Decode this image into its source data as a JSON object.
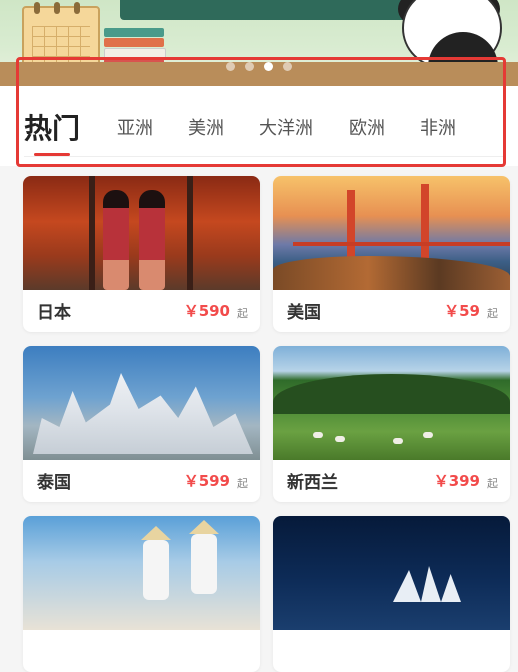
{
  "banner": {
    "carousel_total": 4,
    "carousel_active_index": 2
  },
  "tabs": [
    {
      "label": "热门",
      "active": true
    },
    {
      "label": "亚洲",
      "active": false
    },
    {
      "label": "美洲",
      "active": false
    },
    {
      "label": "大洋洲",
      "active": false
    },
    {
      "label": "欧洲",
      "active": false
    },
    {
      "label": "非洲",
      "active": false
    }
  ],
  "colors": {
    "accent": "#e53935",
    "price": "#f24b4b",
    "background": "#f5f5f5"
  },
  "destinations": [
    {
      "name": "日本",
      "price": "￥590",
      "suffix": "起"
    },
    {
      "name": "美国",
      "price": "￥59",
      "suffix": "起"
    },
    {
      "name": "泰国",
      "price": "￥599",
      "suffix": "起"
    },
    {
      "name": "新西兰",
      "price": "￥399",
      "suffix": "起"
    },
    {
      "name": "",
      "price": "",
      "suffix": ""
    },
    {
      "name": "",
      "price": "",
      "suffix": ""
    }
  ]
}
